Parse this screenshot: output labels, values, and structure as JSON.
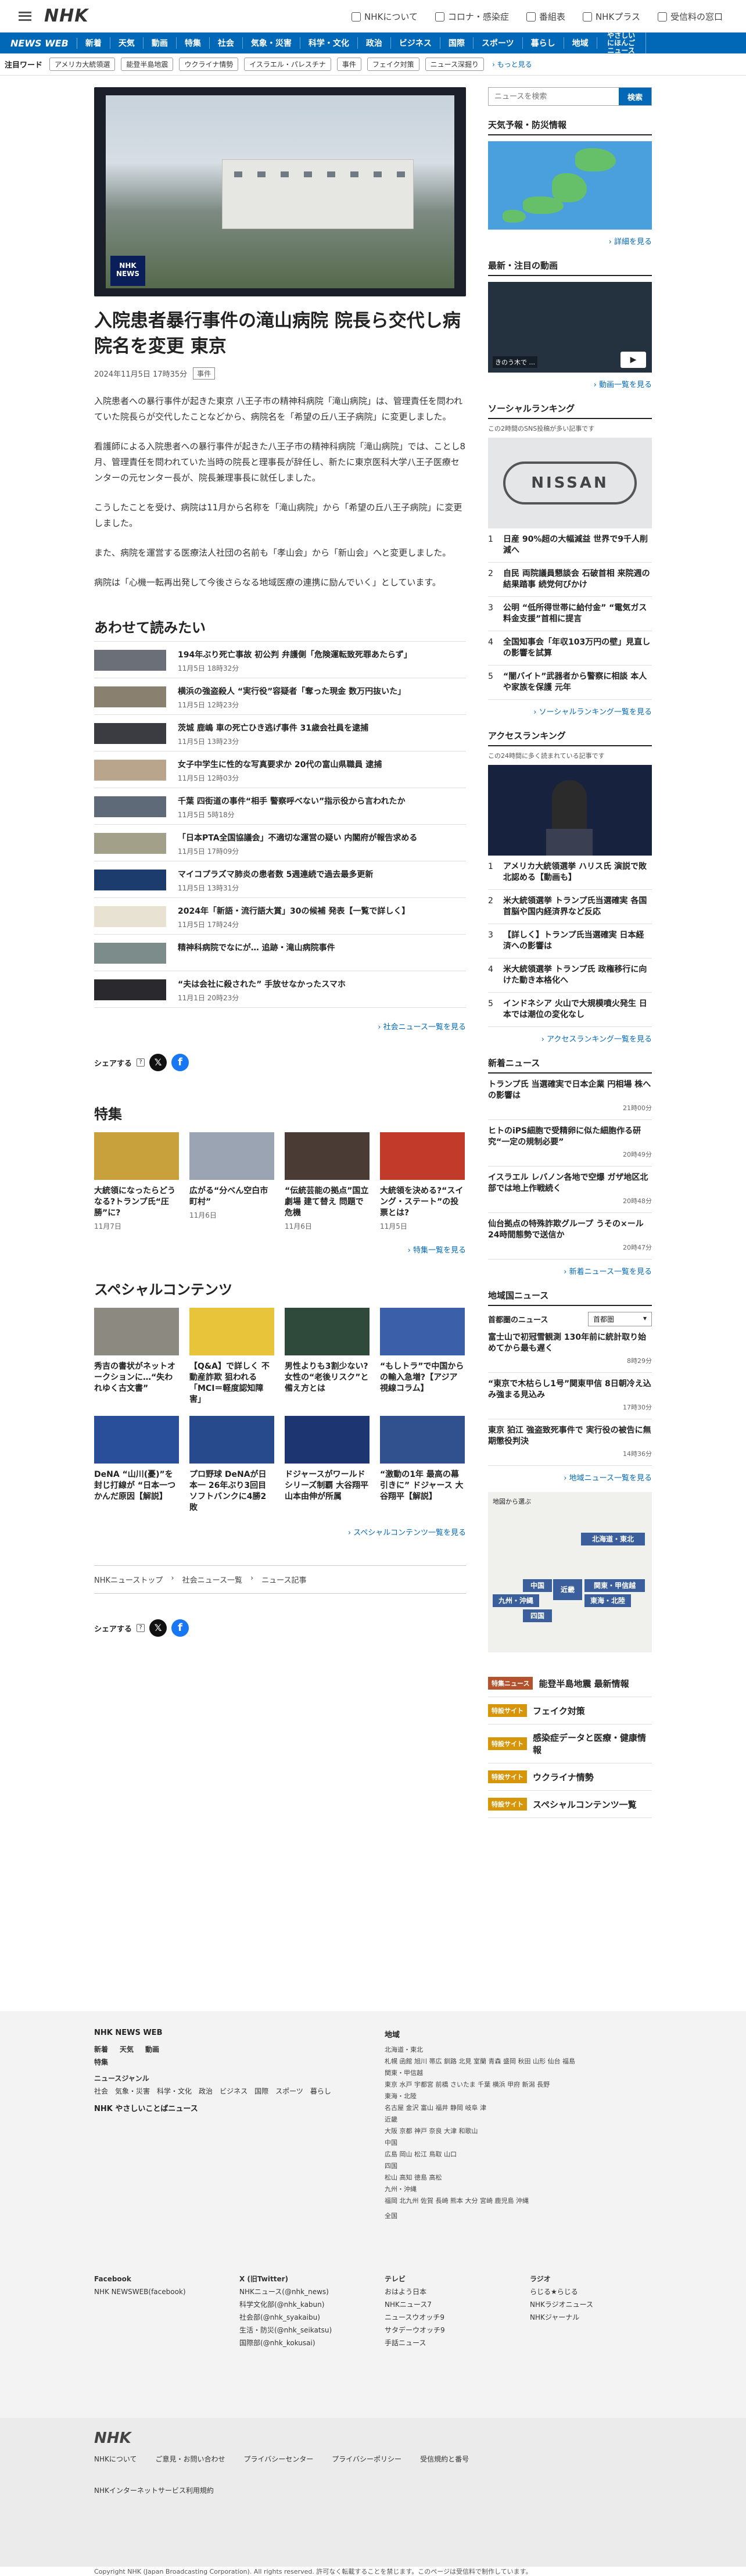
{
  "header": {
    "logo": "NHK",
    "links": [
      "NHKについて",
      "コロナ・感染症",
      "番組表",
      "NHKプラス",
      "受信料の窓口"
    ]
  },
  "nav": {
    "brand": "NEWS WEB",
    "items": [
      "新着",
      "天気",
      "動画",
      "特集",
      "社会",
      "気象・災害",
      "科学・文化",
      "政治",
      "ビジネス",
      "国際",
      "スポーツ",
      "暮らし",
      "地域"
    ],
    "yasashii": "やさしいにほんご ニュース"
  },
  "tags": {
    "label": "注目ワード",
    "items": [
      "アメリカ大統領選",
      "能登半島地震",
      "ウクライナ情勢",
      "イスラエル・パレスチナ",
      "事件",
      "フェイク対策",
      "ニュース深掘り"
    ],
    "more": "もっと見る"
  },
  "hero": {
    "badge": "NHK NEWS"
  },
  "article": {
    "title": "入院患者暴行事件の滝山病院 院長ら交代し病院名を変更 東京",
    "date": "2024年11月5日 17時35分",
    "category": "事件",
    "paragraphs": [
      "入院患者への暴行事件が起きた東京 八王子市の精神科病院「滝山病院」は、管理責任を問われていた院長らが交代したことなどから、病院名を「希望の丘八王子病院」に変更しました。",
      "看護師による入院患者への暴行事件が起きた八王子市の精神科病院「滝山病院」では、ことし8月、管理責任を問われていた当時の院長と理事長が辞任し、新たに東京医科大学八王子医療センターの元センター長が、院長兼理事長に就任しました。",
      "こうしたことを受け、病院は11月から名称を「滝山病院」から「希望の丘八王子病院」に変更しました。",
      "また、病院を運営する医療法人社団の名前も「孝山会」から「新山会」へと変更しました。",
      "病院は「心機一転再出発して今後さらなる地域医療の連携に励んでいく」としています。"
    ]
  },
  "related": {
    "heading": "あわせて読みたい",
    "items": [
      {
        "title": "194年ぶり死亡事故 初公判 弁護側「危険運転致死罪あたらず」",
        "date": "11月5日 18時32分"
      },
      {
        "title": "横浜の強盗殺人 “実行役”容疑者「奪った現金 数万円抜いた」",
        "date": "11月5日 12時23分"
      },
      {
        "title": "茨城 鹿嶋 車の死亡ひき逃げ事件 31歳会社員を逮捕",
        "date": "11月5日 13時23分"
      },
      {
        "title": "女子中学生に性的な写真要求か 20代の富山県職員 逮捕",
        "date": "11月5日 12時03分"
      },
      {
        "title": "千葉 四街道の事件“相手 警察呼べない”指示役から言われたか",
        "date": "11月5日 5時18分"
      },
      {
        "title": "「日本PTA全国協議会」不適切な運営の疑い 内閣府が報告求める",
        "date": "11月5日 17時09分"
      },
      {
        "title": "マイコプラズマ肺炎の患者数 5週連続で過去最多更新",
        "date": "11月5日 13時31分"
      },
      {
        "title": "2024年「新語・流行語大賞」30の候補 発表【一覧で詳しく】",
        "date": "11月5日 17時24分"
      },
      {
        "title": "精神科病院でなにが… 追跡・滝山病院事件",
        "date": ""
      },
      {
        "title": "“夫は会社に殺された” 手放せなかったスマホ",
        "date": "11月1日 20時23分"
      }
    ],
    "more": "社会ニュース一覧を見る"
  },
  "share": {
    "label": "シェアする"
  },
  "tokushu": {
    "heading": "特集",
    "items": [
      {
        "title": "大統領になったらどうなる?トランプ氏“圧勝”に?",
        "date": "11月7日"
      },
      {
        "title": "広がる“分べん空白市町村”",
        "date": "11月6日"
      },
      {
        "title": "“伝統芸能の拠点”国立劇場 建て替え 問題で危機",
        "date": "11月6日"
      },
      {
        "title": "大統領を決める?“スイング・ステート”の投票とは?",
        "date": "11月5日"
      }
    ],
    "more": "特集一覧を見る"
  },
  "special": {
    "heading": "スペシャルコンテンツ",
    "items": [
      {
        "title": "秀吉の書状がネットオークションに…“失われゆく古文書”"
      },
      {
        "title": "【Q&A】で詳しく 不動産詐欺 狙われる「MCI＝軽度認知障害」"
      },
      {
        "title": "男性よりも3割少ない? 女性の“老後リスク”と備え方とは"
      },
      {
        "title": "“もしトラ”で中国からの輸入急増?【アジア視線コラム】"
      },
      {
        "title": "DeNA “山川(憂)”を封じ打線が “日本一つかんだ原因【解説】"
      },
      {
        "title": "プロ野球 DeNAが日本一 26年ぶり3回目 ソフトバンクに4勝2敗"
      },
      {
        "title": "ドジャースがワールドシリーズ制覇 大谷翔平 山本由伸が所属"
      },
      {
        "title": "“激動の1年 最高の幕引きに” ドジャース 大谷翔平【解説】"
      }
    ],
    "more": "スペシャルコンテンツ一覧を見る"
  },
  "breadcrumb": [
    "NHKニューストップ",
    "社会ニュース一覧",
    "ニュース記事"
  ],
  "side": {
    "search_placeholder": "ニュースを検索",
    "search_button": "検索",
    "weather_heading": "天気予報・防災情報",
    "weather_more": "詳細を見る",
    "video_heading": "最新・注目の動画",
    "video_caption": "きのう木で ...",
    "video_more": "動画一覧を見る",
    "social_heading": "ソーシャルランキング",
    "social_note": "この2時間のSNS投稿が多い記事です",
    "social_items": [
      "日産 90%超の大幅減益 世界で9千人削減へ",
      "自民 両院議員懇談会 石破首相 来院週の結果踏事 続党何びかけ",
      "公明 “低所得世帯に給付金” “電気ガス料金支援”首相に提言",
      "全国知事会「年収103万円の壁」見直しの影響を試算",
      "“闇バイト”武器者から警察に相談 本人や家族を保護 元年"
    ],
    "social_more": "ソーシャルランキング一覧を見る",
    "access_heading": "アクセスランキング",
    "access_note": "この24時間に多く読まれている記事です",
    "access_items": [
      "アメリカ大統領選挙 ハリス氏 演説で敗北認める【動画も】",
      "米大統領選挙 トランプ氏当選確実 各国首脳や国内経済界など反応",
      "【詳しく】トランプ氏当選確実 日本経済への影響は",
      "米大統領選挙 トランプ氏 政権移行に向けた動き本格化へ",
      "インドネシア 火山で大規模噴火発生 日本では潮位の変化なし"
    ],
    "access_more": "アクセスランキング一覧を見る",
    "new_heading": "新着ニュース",
    "new_items": [
      {
        "title": "トランプ氏 当選確実で日本企業 円相場 株への影響は",
        "time": "21時00分"
      },
      {
        "title": "ヒトのiPS細胞で受精卵に似た細胞作る研究“一定の規制必要”",
        "time": "20時49分"
      },
      {
        "title": "イスラエル レバノン各地で空爆 ガザ地区北部では地上作戦続く",
        "time": "20時48分"
      },
      {
        "title": "仙台拠点の特殊詐欺グループ うその×ール24時間態勢で送信か",
        "time": "20時47分"
      }
    ],
    "new_more": "新着ニュース一覧を見る",
    "local_heading": "地域国ニュース",
    "local_label": "首都圏のニュース",
    "local_select": "首都圏",
    "local_items": [
      {
        "title": "富士山で初冠雪観測 130年前に統計取り始めてから最も遅く",
        "time": "8時29分"
      },
      {
        "title": "“東京で木枯らし1号”関東甲信 8日朝冷え込み強まる見込み",
        "time": "17時30分"
      },
      {
        "title": "東京 狛江 強盗致死事件で 実行役の被告に無期懲役判決",
        "time": "14時36分"
      }
    ],
    "local_more": "地域ニュース一覧を見る",
    "map_title": "地図から選ぶ",
    "map_regions": [
      "北海道・東北",
      "中国",
      "近畿",
      "関東・甲信越",
      "九州・沖縄",
      "四国",
      "東海・北陸"
    ],
    "specials": [
      {
        "badge": "特集ニュース",
        "title": "能登半島地震 最新情報"
      },
      {
        "badge": "特設サイト",
        "title": "フェイク対策"
      },
      {
        "badge": "特設サイト",
        "title": "感染症データと医療・健康情報"
      },
      {
        "badge": "特設サイト",
        "title": "ウクライナ情勢"
      },
      {
        "badge": "特設サイト",
        "title": "スペシャルコンテンツ一覧"
      }
    ]
  },
  "footer": {
    "title": "NHK NEWS WEB",
    "row1": [
      "新着",
      "天気",
      "動画"
    ],
    "tokushu": "特集",
    "genre_label": "ニュースジャンル",
    "genres": [
      "社会",
      "気象・災害",
      "科学・文化",
      "政治",
      "ビジネス",
      "国際",
      "スポーツ",
      "暮らし"
    ],
    "yasashii": "NHK やさしいことばニュース",
    "region_title": "地域",
    "regions": [
      "北海道・東北",
      "札幌 函館 旭川 帯広 釧路 北見 室蘭 青森 盛岡 秋田 山形 仙台 福島",
      "関東・甲信越",
      "東京 水戸 宇都宮 前橋 さいたま 千葉 横浜 甲府 新潟 長野",
      "東海・北陸",
      "名古屋 金沢 富山 福井 静岡 岐阜 津",
      "近畿",
      "大阪 京都 神戸 奈良 大津 和歌山",
      "中国",
      "広島 岡山 松江 鳥取 山口",
      "四国",
      "松山 高知 徳島 高松",
      "九州・沖縄",
      "福岡 北九州 佐賀 長崎 熊本 大分 宮崎 鹿児島 沖縄",
      "全国"
    ],
    "cols": [
      {
        "h": "Facebook",
        "items": [
          "NHK NEWSWEB(facebook)"
        ]
      },
      {
        "h": "X (旧Twitter)",
        "items": [
          "NHKニュース(@nhk_news)",
          "科学文化部(@nhk_kabun)",
          "社会部(@nhk_syakaibu)",
          "生活・防災(@nhk_seikatsu)",
          "国際部(@nhk_kokusai)"
        ]
      },
      {
        "h": "テレビ",
        "items": [
          "おはよう日本",
          "NHKニュース7",
          "ニュースウオッチ9",
          "サタデーウオッチ9",
          "手話ニュース"
        ]
      },
      {
        "h": "ラジオ",
        "items": [
          "らじる★らじる",
          "NHKラジオニュース",
          "NHKジャーナル"
        ]
      }
    ],
    "bottom_logo": "NHK",
    "bottom_links": [
      "NHKについて",
      "ご意見・お問い合わせ",
      "プライバシーセンター",
      "プライバシーポリシー",
      "受信規約と番号",
      "NHKインターネットサービス利用規約"
    ],
    "copyright": "Copyright NHK (Japan Broadcasting Corporation). All rights reserved. 許可なく転載することを禁じます。このページは受信料で制作しています。"
  },
  "colors": {
    "brand": "#0068b7",
    "special_badge": "#b5522e",
    "special_badge_alt": "#d7960a"
  }
}
